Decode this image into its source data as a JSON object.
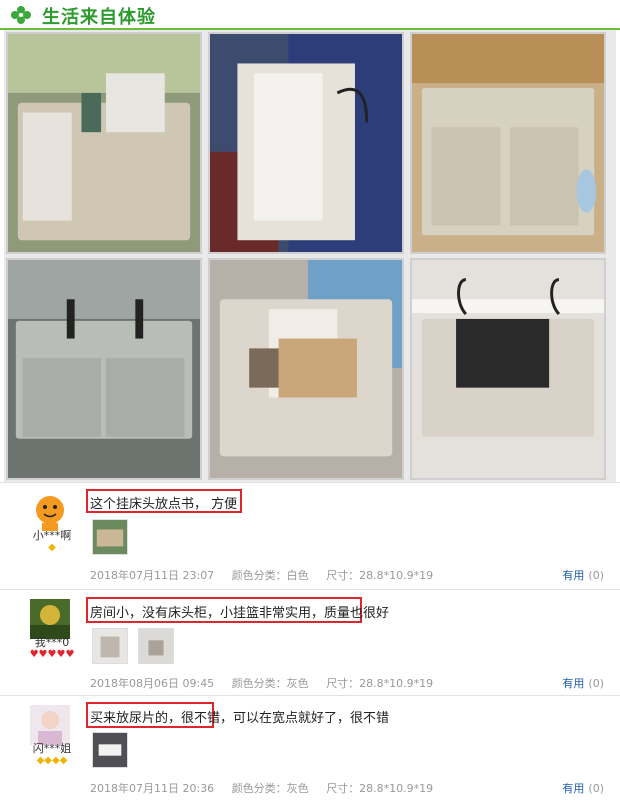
{
  "header": {
    "title": "生活来自体验",
    "icon": "clover-icon",
    "accent": "#2c9a2c"
  },
  "gallery": {
    "photos": [
      {
        "label": "beige-storage-pocket-with-mesh-side"
      },
      {
        "label": "storage-pocket-hooked-on-blue-mattress"
      },
      {
        "label": "pocket-on-wooden-bed-rail-with-hooks"
      },
      {
        "label": "grey-pocket-on-metal-rail"
      },
      {
        "label": "pocket-filled-with-books"
      },
      {
        "label": "pocket-holding-wallet"
      }
    ]
  },
  "reviews": [
    {
      "username": "小***啊",
      "level_icons": "◆",
      "level_color": "#f0b400",
      "comment": "这个挂床头放点书，  方便",
      "thumbnails": 1,
      "date": "2018年07月11日 23:07",
      "color_label": "颜色分类：白色",
      "size_label": "尺寸：28.8*10.9*19",
      "helpful_label": "有用",
      "helpful_count": "(0)"
    },
    {
      "username": "我***0",
      "level_icons": "♥♥♥♥♥",
      "level_color": "#e0262d",
      "comment": "房间小，没有床头柜，小挂篮非常实用，质量也很好",
      "thumbnails": 2,
      "date": "2018年08月06日 09:45",
      "color_label": "颜色分类：灰色",
      "size_label": "尺寸：28.8*10.9*19",
      "helpful_label": "有用",
      "helpful_count": "(0)"
    },
    {
      "username": "闪***姐",
      "level_icons": "◆◆◆◆",
      "level_color": "#f0b400",
      "comment": "买来放尿片的，很不错，可以在宽点就好了，很不错",
      "thumbnails": 1,
      "date": "2018年07月11日 20:36",
      "color_label": "颜色分类：灰色",
      "size_label": "尺寸：28.8*10.9*19",
      "helpful_label": "有用",
      "helpful_count": "(0)"
    }
  ]
}
